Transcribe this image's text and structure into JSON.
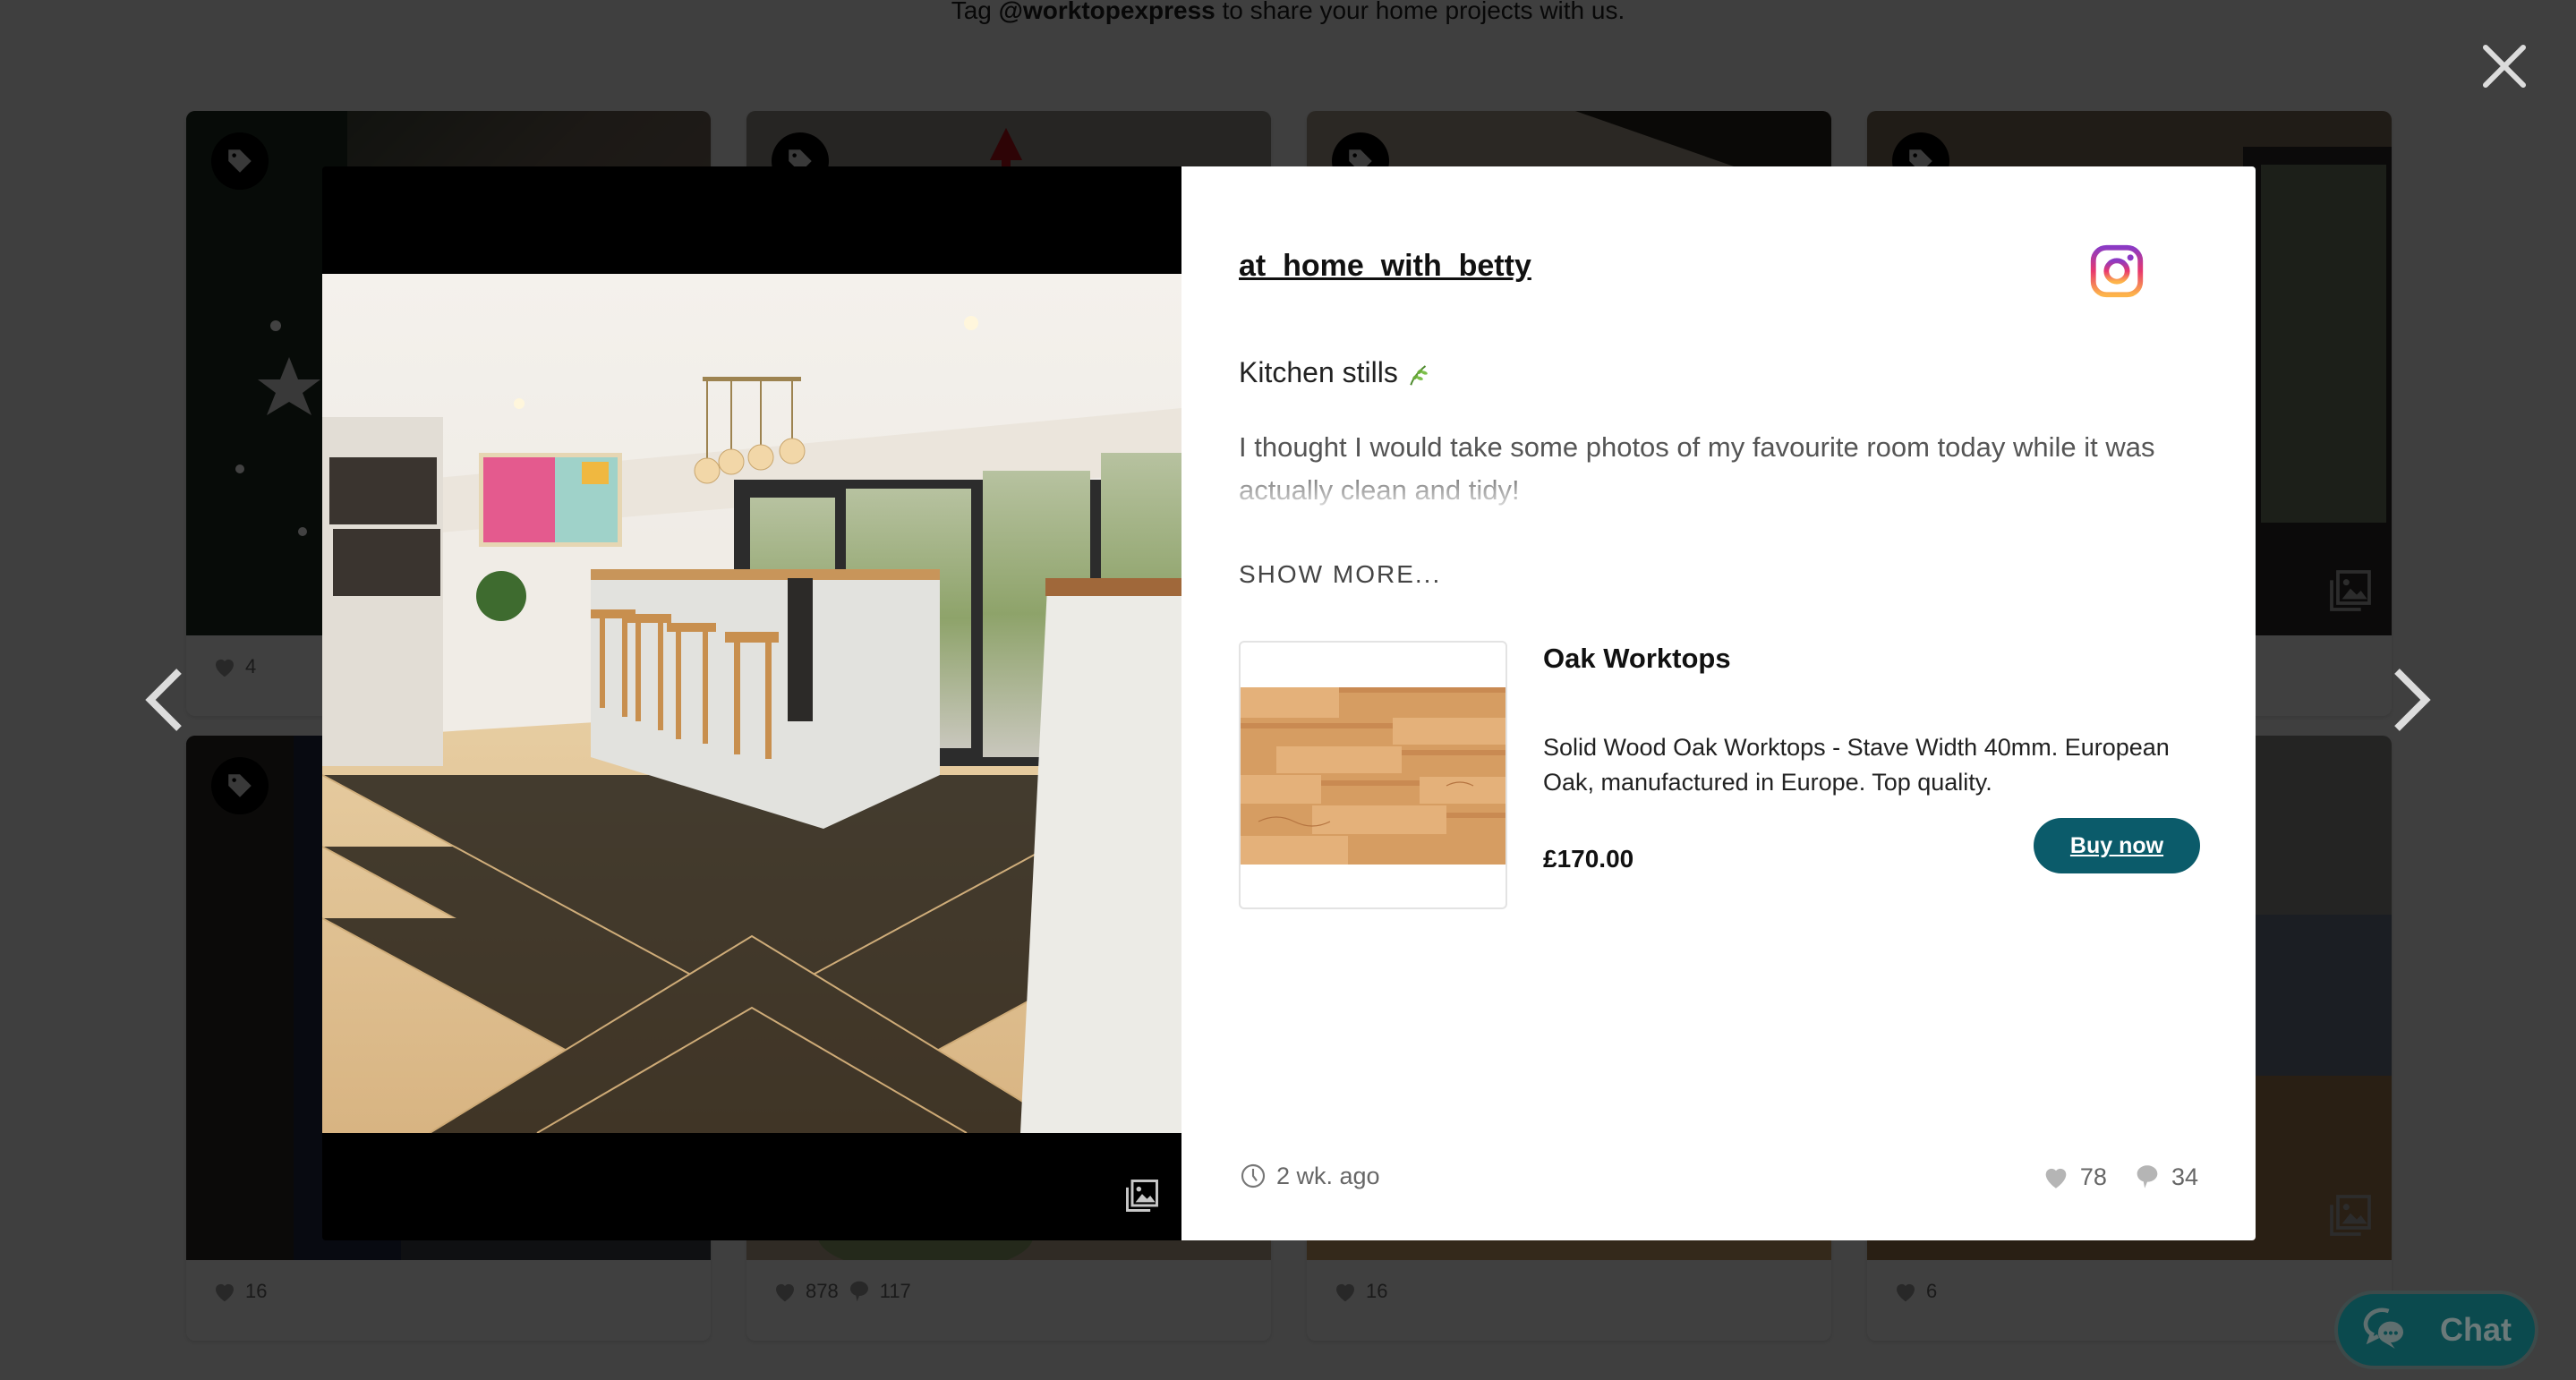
{
  "page": {
    "tagline_prefix": "Tag ",
    "tagline_handle": "@worktopexpress",
    "tagline_suffix": " to share your home projects with us."
  },
  "grid": {
    "tiles": [
      {
        "likes": "4",
        "comments": null
      },
      {
        "likes": "",
        "comments": null
      },
      {
        "likes": "",
        "comments": null
      },
      {
        "likes": "",
        "comments": null
      },
      {
        "likes": "16",
        "comments": null
      },
      {
        "likes": "878",
        "comments": "117"
      },
      {
        "likes": "16",
        "comments": null
      },
      {
        "likes": "6",
        "comments": null
      }
    ]
  },
  "modal": {
    "author": "at_home_with_betty",
    "source_icon": "instagram-icon",
    "caption_title": "Kitchen stills",
    "caption_body": "I thought I would take some photos of my favourite room today while it was actually clean and tidy!",
    "show_more": "SHOW MORE...",
    "product": {
      "name": "Oak Worktops",
      "description": "Solid Wood Oak Worktops - Stave Width 40mm. European Oak, manufactured in Europe. Top quality.",
      "price": "£170.00",
      "buy_label": "Buy now"
    },
    "posted": "2 wk. ago",
    "likes": "78",
    "comments": "34"
  },
  "controls": {
    "close_icon": "close-icon",
    "prev_icon": "chevron-left-icon",
    "next_icon": "chevron-right-icon"
  },
  "chat": {
    "label": "Chat"
  },
  "colors": {
    "accent": "#0b5b6a",
    "chat_bg": "#0b4a4e",
    "overlay": "#000000"
  }
}
